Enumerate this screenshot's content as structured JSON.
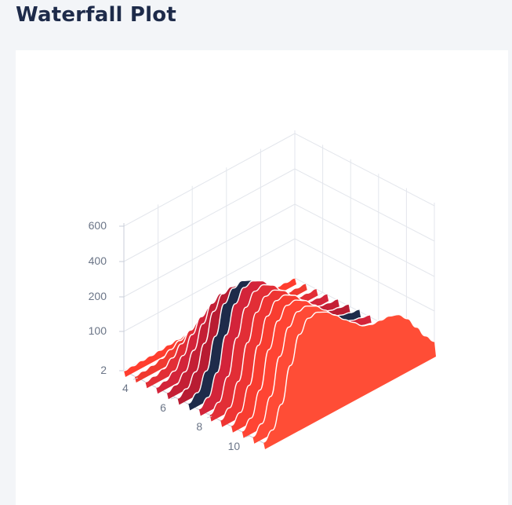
{
  "page": {
    "title": "Waterfall Plot"
  },
  "chart_data": {
    "type": "waterfall-3d",
    "title": "",
    "xlabel": "",
    "ylabel": "",
    "zlabel": "",
    "z_ticks": [
      "2",
      "100",
      "200",
      "400",
      "600"
    ],
    "depth_ticks": [
      "4",
      "6",
      "8",
      "10"
    ],
    "grid": true,
    "legend": "none",
    "highlight_color": "#1e2b4a",
    "series_colors": [
      "#ff3d2e",
      "#f03a30",
      "#e22e36",
      "#d3243a",
      "#c41f35",
      "#b81c32",
      "#c41f35",
      "#d3243a",
      "#e22e36",
      "#ee3533",
      "#f83d30",
      "#ff4433",
      "#ff4a36",
      "#ff4d36"
    ],
    "highlight_index": 6,
    "series": [
      {
        "values": [
          2,
          2,
          3,
          3,
          4,
          6,
          7,
          8,
          8,
          7,
          5,
          4,
          3,
          3,
          4,
          5,
          5,
          4,
          3,
          2
        ]
      },
      {
        "values": [
          2,
          3,
          5,
          10,
          20,
          30,
          36,
          36,
          32,
          26,
          20,
          14,
          10,
          8,
          7,
          6,
          5,
          4,
          3,
          2
        ]
      },
      {
        "values": [
          2,
          4,
          10,
          25,
          48,
          70,
          82,
          80,
          70,
          56,
          42,
          30,
          22,
          18,
          14,
          10,
          8,
          6,
          4,
          3
        ]
      },
      {
        "values": [
          2,
          6,
          18,
          45,
          85,
          120,
          135,
          130,
          112,
          90,
          68,
          50,
          38,
          30,
          24,
          18,
          13,
          9,
          6,
          4
        ]
      },
      {
        "values": [
          3,
          10,
          30,
          72,
          130,
          175,
          190,
          180,
          155,
          122,
          94,
          70,
          54,
          42,
          32,
          24,
          17,
          12,
          8,
          5
        ]
      },
      {
        "values": [
          3,
          14,
          44,
          104,
          182,
          236,
          250,
          235,
          200,
          158,
          120,
          90,
          70,
          54,
          40,
          30,
          22,
          15,
          10,
          6
        ]
      },
      {
        "values": [
          4,
          18,
          60,
          140,
          240,
          300,
          315,
          290,
          240,
          185,
          140,
          105,
          82,
          62,
          46,
          34,
          25,
          17,
          11,
          7
        ]
      },
      {
        "values": [
          4,
          20,
          70,
          160,
          270,
          335,
          345,
          318,
          262,
          200,
          150,
          112,
          88,
          68,
          50,
          36,
          26,
          18,
          12,
          7
        ]
      },
      {
        "values": [
          4,
          22,
          74,
          168,
          282,
          345,
          355,
          325,
          268,
          205,
          155,
          118,
          92,
          72,
          54,
          40,
          28,
          19,
          12,
          7
        ]
      },
      {
        "values": [
          4,
          22,
          76,
          170,
          285,
          348,
          356,
          326,
          270,
          208,
          158,
          124,
          98,
          78,
          60,
          45,
          32,
          22,
          14,
          8
        ]
      },
      {
        "values": [
          4,
          24,
          80,
          178,
          295,
          355,
          360,
          330,
          275,
          214,
          166,
          132,
          106,
          88,
          70,
          55,
          40,
          28,
          18,
          10
        ]
      },
      {
        "values": [
          4,
          24,
          82,
          182,
          300,
          360,
          362,
          332,
          280,
          222,
          176,
          144,
          120,
          102,
          88,
          72,
          56,
          40,
          26,
          14
        ]
      },
      {
        "values": [
          4,
          24,
          80,
          178,
          296,
          356,
          360,
          332,
          282,
          228,
          186,
          158,
          140,
          130,
          124,
          112,
          92,
          66,
          40,
          20
        ]
      },
      {
        "values": [
          4,
          22,
          74,
          168,
          286,
          350,
          356,
          330,
          284,
          232,
          194,
          170,
          160,
          158,
          156,
          146,
          120,
          84,
          50,
          24
        ]
      }
    ]
  }
}
